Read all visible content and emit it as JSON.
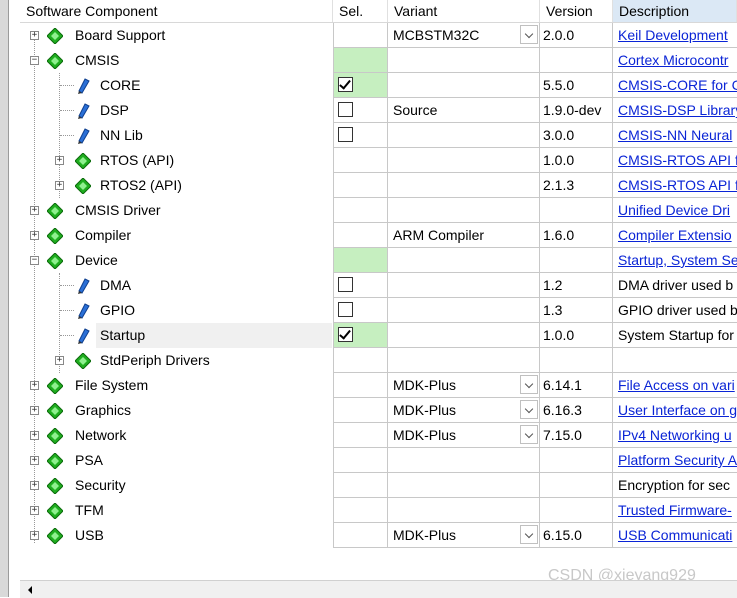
{
  "header": {
    "component": "Software Component",
    "sel": "Sel.",
    "variant": "Variant",
    "version": "Version",
    "description": "Description"
  },
  "rows": [
    {
      "label": "Board Support",
      "variant": "MCBSTM32C",
      "version": "2.0.0",
      "desc": "Keil Development",
      "link": true,
      "dropdown": true
    },
    {
      "label": "CMSIS",
      "variant": "",
      "version": "",
      "desc": "Cortex Microcontr",
      "link": true
    },
    {
      "label": "CORE",
      "variant": "",
      "version": "5.5.0",
      "desc": "CMSIS-CORE for C",
      "link": true,
      "checked": true
    },
    {
      "label": "DSP",
      "variant": "Source",
      "version": "1.9.0-dev",
      "desc": "CMSIS-DSP Library",
      "link": true
    },
    {
      "label": "NN Lib",
      "variant": "",
      "version": "3.0.0",
      "desc": "CMSIS-NN Neural",
      "link": true
    },
    {
      "label": "RTOS (API)",
      "variant": "",
      "version": "1.0.0",
      "desc": "CMSIS-RTOS API fo",
      "link": true
    },
    {
      "label": "RTOS2 (API)",
      "variant": "",
      "version": "2.1.3",
      "desc": "CMSIS-RTOS API fo",
      "link": true
    },
    {
      "label": "CMSIS Driver",
      "variant": "",
      "version": "",
      "desc": "Unified Device Dri",
      "link": true
    },
    {
      "label": "Compiler",
      "variant": "ARM Compiler",
      "version": "1.6.0",
      "desc": "Compiler Extensio",
      "link": true
    },
    {
      "label": "Device",
      "variant": "",
      "version": "",
      "desc": "Startup, System Se",
      "link": true
    },
    {
      "label": "DMA",
      "variant": "",
      "version": "1.2",
      "desc": "DMA driver used b",
      "link": false
    },
    {
      "label": "GPIO",
      "variant": "",
      "version": "1.3",
      "desc": "GPIO driver used b",
      "link": false
    },
    {
      "label": "Startup",
      "variant": "",
      "version": "1.0.0",
      "desc": "System Startup for",
      "link": false,
      "checked": true
    },
    {
      "label": "StdPeriph Drivers",
      "variant": "",
      "version": "",
      "desc": "",
      "link": false
    },
    {
      "label": "File System",
      "variant": "MDK-Plus",
      "version": "6.14.1",
      "desc": "File Access on vari",
      "link": true,
      "dropdown": true
    },
    {
      "label": "Graphics",
      "variant": "MDK-Plus",
      "version": "6.16.3",
      "desc": "User Interface on g",
      "link": true,
      "dropdown": true
    },
    {
      "label": "Network",
      "variant": "MDK-Plus",
      "version": "7.15.0",
      "desc": "IPv4 Networking u",
      "link": true,
      "dropdown": true
    },
    {
      "label": "PSA",
      "variant": "",
      "version": "",
      "desc": "Platform Security A",
      "link": true
    },
    {
      "label": "Security",
      "variant": "",
      "version": "",
      "desc": "Encryption for sec",
      "link": false
    },
    {
      "label": "TFM",
      "variant": "",
      "version": "",
      "desc": "Trusted Firmware-",
      "link": true
    },
    {
      "label": "USB",
      "variant": "MDK-Plus",
      "version": "6.15.0",
      "desc": "USB Communicati",
      "link": true,
      "dropdown": true
    }
  ],
  "watermark": "CSDN @xieyang929",
  "colors": {
    "link": "#0a24d6",
    "selected_green": "#c6efc0",
    "gem_green": "#1fae1f",
    "pin_blue": "#2a6fd6"
  }
}
